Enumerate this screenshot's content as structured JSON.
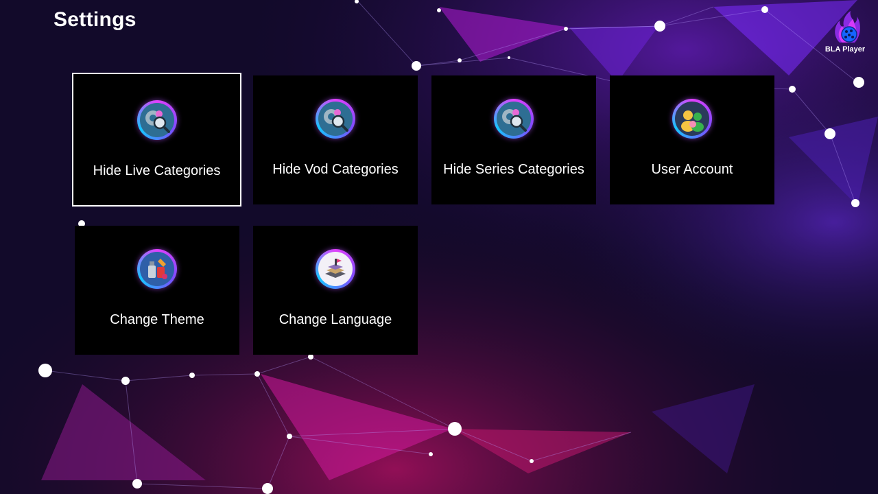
{
  "header": {
    "title": "Settings"
  },
  "brand": {
    "name": "BLA Player",
    "icon": "flame-globe-logo"
  },
  "tiles": [
    {
      "label": "Hide Live Categories",
      "icon": "gear-search-icon",
      "focused": true
    },
    {
      "label": "Hide Vod Categories",
      "icon": "gear-search-icon",
      "focused": false
    },
    {
      "label": "Hide Series Categories",
      "icon": "gear-search-icon",
      "focused": false
    },
    {
      "label": "User Account",
      "icon": "users-icon",
      "focused": false
    },
    {
      "label": "Change Theme",
      "icon": "paint-icon",
      "focused": false
    },
    {
      "label": "Change Language",
      "icon": "language-stack-icon",
      "focused": false
    }
  ],
  "colors": {
    "tile_bg": "#000000",
    "focus_border": "#ffffff",
    "accent_pink": "#e040fb",
    "accent_blue": "#18c5ff"
  }
}
